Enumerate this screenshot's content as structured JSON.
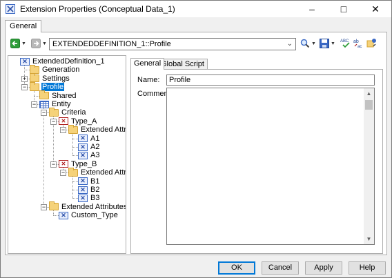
{
  "window": {
    "title": "Extension Properties (Conceptual Data_1)",
    "controls": {
      "minimize": "–",
      "maximize": "□",
      "close": "✕"
    }
  },
  "outer_tab": {
    "label": "General"
  },
  "toolbar": {
    "path_value": "EXTENDEDDEFINITION_1::Profile",
    "icons": [
      "back-icon",
      "forward-icon",
      "find-icon",
      "save-icon",
      "spell-check-icon",
      "rename-icon",
      "properties-icon"
    ]
  },
  "tree": {
    "nodes": [
      {
        "label": "ExtendedDefinition_1",
        "icon": "x-icon"
      },
      {
        "label": "Generation",
        "icon": "folder-icon"
      },
      {
        "label": "Settings",
        "icon": "folder-icon"
      },
      {
        "label": "Profile",
        "icon": "folder-icon",
        "selected": true
      },
      {
        "label": "Shared",
        "icon": "folder-icon"
      },
      {
        "label": "Entity",
        "icon": "table-icon"
      },
      {
        "label": "Criteria",
        "icon": "folder-icon"
      },
      {
        "label": "Type_A",
        "icon": "type-icon"
      },
      {
        "label": "Extended Attributes",
        "icon": "folder-icon"
      },
      {
        "label": "A1",
        "icon": "x-icon"
      },
      {
        "label": "A2",
        "icon": "x-icon"
      },
      {
        "label": "A3",
        "icon": "x-icon"
      },
      {
        "label": "Type_B",
        "icon": "type-icon"
      },
      {
        "label": "Extended Attributes",
        "icon": "folder-icon"
      },
      {
        "label": "B1",
        "icon": "x-icon"
      },
      {
        "label": "B2",
        "icon": "x-icon"
      },
      {
        "label": "B3",
        "icon": "x-icon"
      },
      {
        "label": "Extended Attributes",
        "icon": "folder-icon"
      },
      {
        "label": "Custom_Type",
        "icon": "x-icon"
      }
    ]
  },
  "details": {
    "tabs": [
      {
        "label": "General",
        "active": true
      },
      {
        "label": "Global Script",
        "active": false
      }
    ],
    "name_label": "Name:",
    "name_value": "Profile",
    "comment_label": "Comment:",
    "comment_value": ""
  },
  "buttons": {
    "ok": "OK",
    "cancel": "Cancel",
    "apply": "Apply",
    "help": "Help"
  },
  "colors": {
    "selection": "#0078d7",
    "accent_green": "#2e9d3a"
  }
}
